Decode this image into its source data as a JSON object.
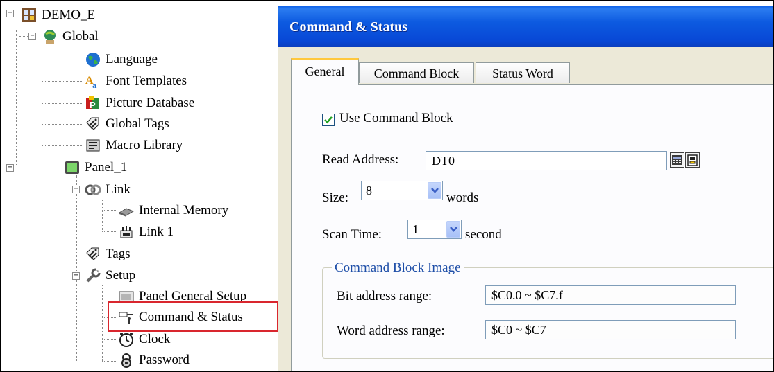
{
  "tree": {
    "nodes": [
      {
        "id": "root",
        "label": "DEMO_E",
        "icon": "project-icon"
      },
      {
        "id": "global",
        "label": "Global",
        "icon": "global-settings-icon"
      },
      {
        "id": "language",
        "label": "Language",
        "icon": "globe-icon"
      },
      {
        "id": "font_templates",
        "label": "Font Templates",
        "icon": "font-icon"
      },
      {
        "id": "picture_database",
        "label": "Picture Database",
        "icon": "picture-icon"
      },
      {
        "id": "global_tags",
        "label": "Global Tags",
        "icon": "tags-icon"
      },
      {
        "id": "macro_library",
        "label": "Macro Library",
        "icon": "book-icon"
      },
      {
        "id": "panel_1",
        "label": "Panel_1",
        "icon": "panel-icon"
      },
      {
        "id": "link",
        "label": "Link",
        "icon": "link-icon"
      },
      {
        "id": "internal_memory",
        "label": "Internal Memory",
        "icon": "chip-icon"
      },
      {
        "id": "link_1",
        "label": "Link 1",
        "icon": "network-icon"
      },
      {
        "id": "tags",
        "label": "Tags",
        "icon": "tags-icon"
      },
      {
        "id": "setup",
        "label": "Setup",
        "icon": "wrench-icon"
      },
      {
        "id": "panel_general_setup",
        "label": "Panel General Setup",
        "icon": "panel-setup-icon"
      },
      {
        "id": "command_status",
        "label": "Command & Status",
        "icon": "command-icon",
        "selected": true
      },
      {
        "id": "clock",
        "label": "Clock",
        "icon": "clock-icon"
      },
      {
        "id": "password",
        "label": "Password",
        "icon": "lock-icon"
      }
    ],
    "expander_symbol": "−"
  },
  "dialog": {
    "title": "Command & Status",
    "tabs": [
      {
        "label": "General",
        "active": true
      },
      {
        "label": "Command Block",
        "active": false
      },
      {
        "label": "Status Word",
        "active": false
      }
    ],
    "use_command_block": {
      "label": "Use Command Block",
      "checked": true
    },
    "read_address": {
      "label": "Read Address:",
      "value": "DT0"
    },
    "size": {
      "label": "Size:",
      "value": "8",
      "unit": "words"
    },
    "scan_time": {
      "label": "Scan Time:",
      "value": "1",
      "unit": "second"
    },
    "command_block_image": {
      "title": "Command Block Image",
      "bit_label": "Bit address range:",
      "bit_value": "$C0.0 ~ $C7.f",
      "word_label": "Word address range:",
      "word_value": "$C0 ~ $C7"
    }
  },
  "colors": {
    "title_bar": "#0a5de8",
    "tab_highlight": "#ffc83c",
    "selection_box": "#d9262e",
    "group_title": "#1f4fa8",
    "dialog_bg": "#ece9d8"
  }
}
